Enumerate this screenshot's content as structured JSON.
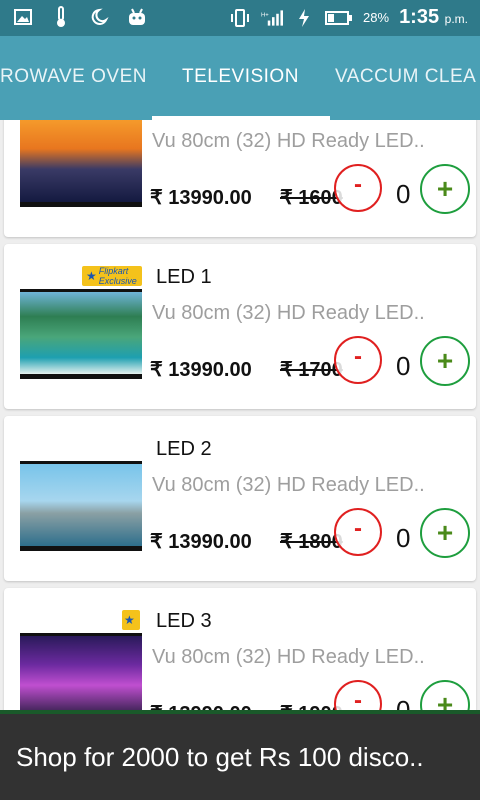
{
  "status_bar": {
    "battery_percent": "28%",
    "time": "1:35",
    "time_suffix": "p.m.",
    "icons": [
      "image-icon",
      "thermometer-icon",
      "moon-icon",
      "android-icon",
      "vibrate-icon",
      "signal-icon",
      "charging-icon",
      "battery-icon"
    ]
  },
  "tabs": [
    {
      "label": "ROWAVE OVEN",
      "active": false
    },
    {
      "label": "TELEVISION",
      "active": true
    },
    {
      "label": "VACCUM CLEA",
      "active": false
    }
  ],
  "products": [
    {
      "name": "",
      "description": "Vu 80cm (32) HD Ready LED..",
      "price": "₹ 13990.00",
      "mrp": "₹ 1600",
      "qty_tail": "0",
      "minus": "-",
      "plus": "+",
      "badge": false
    },
    {
      "name": "LED 1",
      "description": "Vu 80cm (32) HD Ready LED..",
      "price": "₹ 13990.00",
      "mrp": "₹ 1700",
      "qty_tail": "0",
      "minus": "-",
      "plus": "+",
      "badge": true
    },
    {
      "name": "LED 2",
      "description": "Vu 80cm (32) HD Ready LED..",
      "price": "₹ 13990.00",
      "mrp": "₹ 1800",
      "qty_tail": "0",
      "minus": "-",
      "plus": "+",
      "badge": false
    },
    {
      "name": "LED 3",
      "description": "Vu 80cm (32) HD Ready LED..",
      "price": "₹ 13990.00",
      "mrp": "₹ 1900",
      "qty_tail": "0",
      "minus": "-",
      "plus": "+",
      "badge": true
    }
  ],
  "badge_text": "Flipkart Exclusive",
  "snackbar": {
    "message": "Shop for 2000 to get Rs 100 disco.."
  },
  "colors": {
    "status_bar": "#2f7a8a",
    "tab_bar": "#4aa0b5",
    "minus": "#e02020",
    "plus": "#1e9e3e",
    "snackbar": "#323232"
  }
}
